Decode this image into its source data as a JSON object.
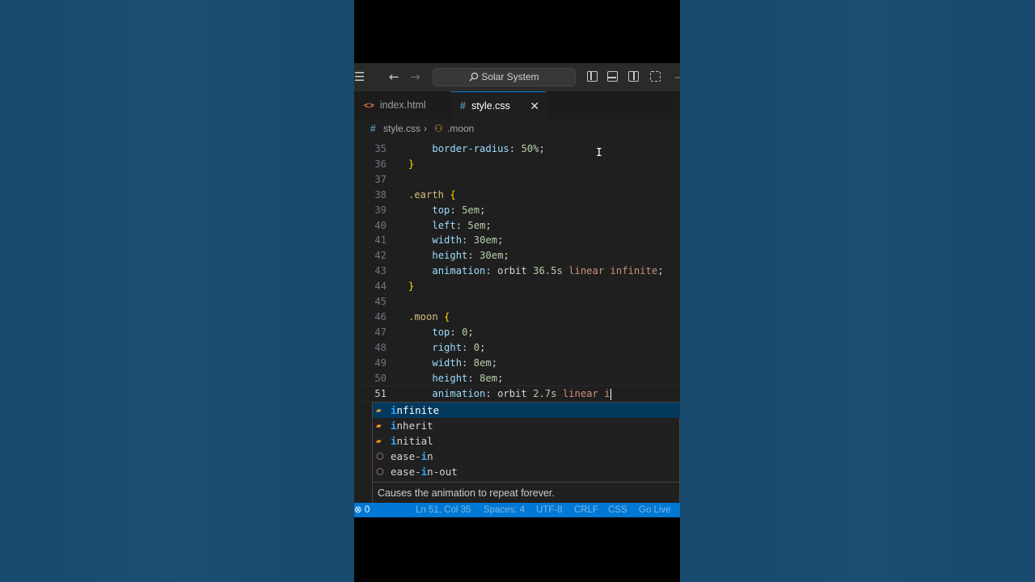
{
  "titlebar": {
    "search_label": "Solar System",
    "icons": [
      "menu-icon",
      "back-arrow-icon",
      "forward-arrow-icon",
      "search-icon",
      "toggle-primary-sidebar-icon",
      "toggle-panel-icon",
      "toggle-secondary-sidebar-icon",
      "customize-layout-icon"
    ]
  },
  "tabs": [
    {
      "label": "index.html",
      "icon": "html-file-icon",
      "active": false
    },
    {
      "label": "style.css",
      "icon": "css-file-icon",
      "active": true,
      "close": "✕"
    }
  ],
  "breadcrumb": {
    "file": "style.css",
    "symbol": ".moon"
  },
  "editor": {
    "lines": [
      {
        "n": "35",
        "indent": "    ",
        "tokens": [
          {
            "t": "border-radius",
            "c": "prop"
          },
          {
            "t": ": ",
            "c": "plain"
          },
          {
            "t": "50%",
            "c": "num"
          },
          {
            "t": ";",
            "c": "plain"
          }
        ]
      },
      {
        "n": "36",
        "indent": "",
        "tokens": [
          {
            "t": "}",
            "c": "brace"
          }
        ]
      },
      {
        "n": "37",
        "indent": "",
        "tokens": []
      },
      {
        "n": "38",
        "indent": "",
        "tokens": [
          {
            "t": ".earth",
            "c": "sel"
          },
          {
            "t": " ",
            "c": "plain"
          },
          {
            "t": "{",
            "c": "brace"
          }
        ]
      },
      {
        "n": "39",
        "indent": "    ",
        "tokens": [
          {
            "t": "top",
            "c": "prop"
          },
          {
            "t": ": ",
            "c": "plain"
          },
          {
            "t": "5em",
            "c": "num"
          },
          {
            "t": ";",
            "c": "plain"
          }
        ]
      },
      {
        "n": "40",
        "indent": "    ",
        "tokens": [
          {
            "t": "left",
            "c": "prop"
          },
          {
            "t": ": ",
            "c": "plain"
          },
          {
            "t": "5em",
            "c": "num"
          },
          {
            "t": ";",
            "c": "plain"
          }
        ]
      },
      {
        "n": "41",
        "indent": "    ",
        "tokens": [
          {
            "t": "width",
            "c": "prop"
          },
          {
            "t": ": ",
            "c": "plain"
          },
          {
            "t": "30em",
            "c": "num"
          },
          {
            "t": ";",
            "c": "plain"
          }
        ]
      },
      {
        "n": "42",
        "indent": "    ",
        "tokens": [
          {
            "t": "height",
            "c": "prop"
          },
          {
            "t": ": ",
            "c": "plain"
          },
          {
            "t": "30em",
            "c": "num"
          },
          {
            "t": ";",
            "c": "plain"
          }
        ]
      },
      {
        "n": "43",
        "indent": "    ",
        "tokens": [
          {
            "t": "animation",
            "c": "prop"
          },
          {
            "t": ": orbit ",
            "c": "plain"
          },
          {
            "t": "36.5s",
            "c": "num"
          },
          {
            "t": " ",
            "c": "plain"
          },
          {
            "t": "linear",
            "c": "kw"
          },
          {
            "t": " ",
            "c": "plain"
          },
          {
            "t": "infinite",
            "c": "kw"
          },
          {
            "t": ";",
            "c": "plain"
          }
        ]
      },
      {
        "n": "44",
        "indent": "",
        "tokens": [
          {
            "t": "}",
            "c": "brace"
          }
        ]
      },
      {
        "n": "45",
        "indent": "",
        "tokens": []
      },
      {
        "n": "46",
        "indent": "",
        "tokens": [
          {
            "t": ".moon",
            "c": "sel"
          },
          {
            "t": " ",
            "c": "plain"
          },
          {
            "t": "{",
            "c": "brace"
          }
        ]
      },
      {
        "n": "47",
        "indent": "    ",
        "tokens": [
          {
            "t": "top",
            "c": "prop"
          },
          {
            "t": ": ",
            "c": "plain"
          },
          {
            "t": "0",
            "c": "num"
          },
          {
            "t": ";",
            "c": "plain"
          }
        ]
      },
      {
        "n": "48",
        "indent": "    ",
        "tokens": [
          {
            "t": "right",
            "c": "prop"
          },
          {
            "t": ": ",
            "c": "plain"
          },
          {
            "t": "0",
            "c": "num"
          },
          {
            "t": ";",
            "c": "plain"
          }
        ]
      },
      {
        "n": "49",
        "indent": "    ",
        "tokens": [
          {
            "t": "width",
            "c": "prop"
          },
          {
            "t": ": ",
            "c": "plain"
          },
          {
            "t": "8em",
            "c": "num"
          },
          {
            "t": ";",
            "c": "plain"
          }
        ]
      },
      {
        "n": "50",
        "indent": "    ",
        "tokens": [
          {
            "t": "height",
            "c": "prop"
          },
          {
            "t": ": ",
            "c": "plain"
          },
          {
            "t": "8em",
            "c": "num"
          },
          {
            "t": ";",
            "c": "plain"
          }
        ]
      },
      {
        "n": "51",
        "indent": "    ",
        "current": true,
        "tokens": [
          {
            "t": "animation",
            "c": "prop"
          },
          {
            "t": ": orbit ",
            "c": "plain"
          },
          {
            "t": "2.7s",
            "c": "num"
          },
          {
            "t": " ",
            "c": "plain"
          },
          {
            "t": "linear",
            "c": "kw"
          },
          {
            "t": " ",
            "c": "plain"
          },
          {
            "t": "i",
            "c": "kw"
          }
        ]
      }
    ]
  },
  "suggest": {
    "items": [
      {
        "hl": "i",
        "rest": "nfinite",
        "pre": "",
        "icon": "enum-value-icon",
        "selected": true
      },
      {
        "hl": "i",
        "rest": "nherit",
        "pre": "",
        "icon": "enum-value-icon",
        "selected": false
      },
      {
        "hl": "i",
        "rest": "nitial",
        "pre": "",
        "icon": "enum-value-icon",
        "selected": false
      },
      {
        "hl": "i",
        "rest": "n",
        "pre": "ease-",
        "icon": "property-icon",
        "selected": false
      },
      {
        "hl": "i",
        "rest": "n-out",
        "pre": "ease-",
        "icon": "property-icon",
        "selected": false
      }
    ],
    "detail": "Causes the animation to repeat forever."
  },
  "statusbar": {
    "problems": "0",
    "items": [
      "Ln 51, Col 35",
      "Spaces: 4",
      "UTF-8",
      "CRLF",
      "CSS",
      "Go Live"
    ]
  },
  "colors": {
    "accent": "#0078d4",
    "background": "#174a6c",
    "editor_bg": "#1f1f1f"
  }
}
